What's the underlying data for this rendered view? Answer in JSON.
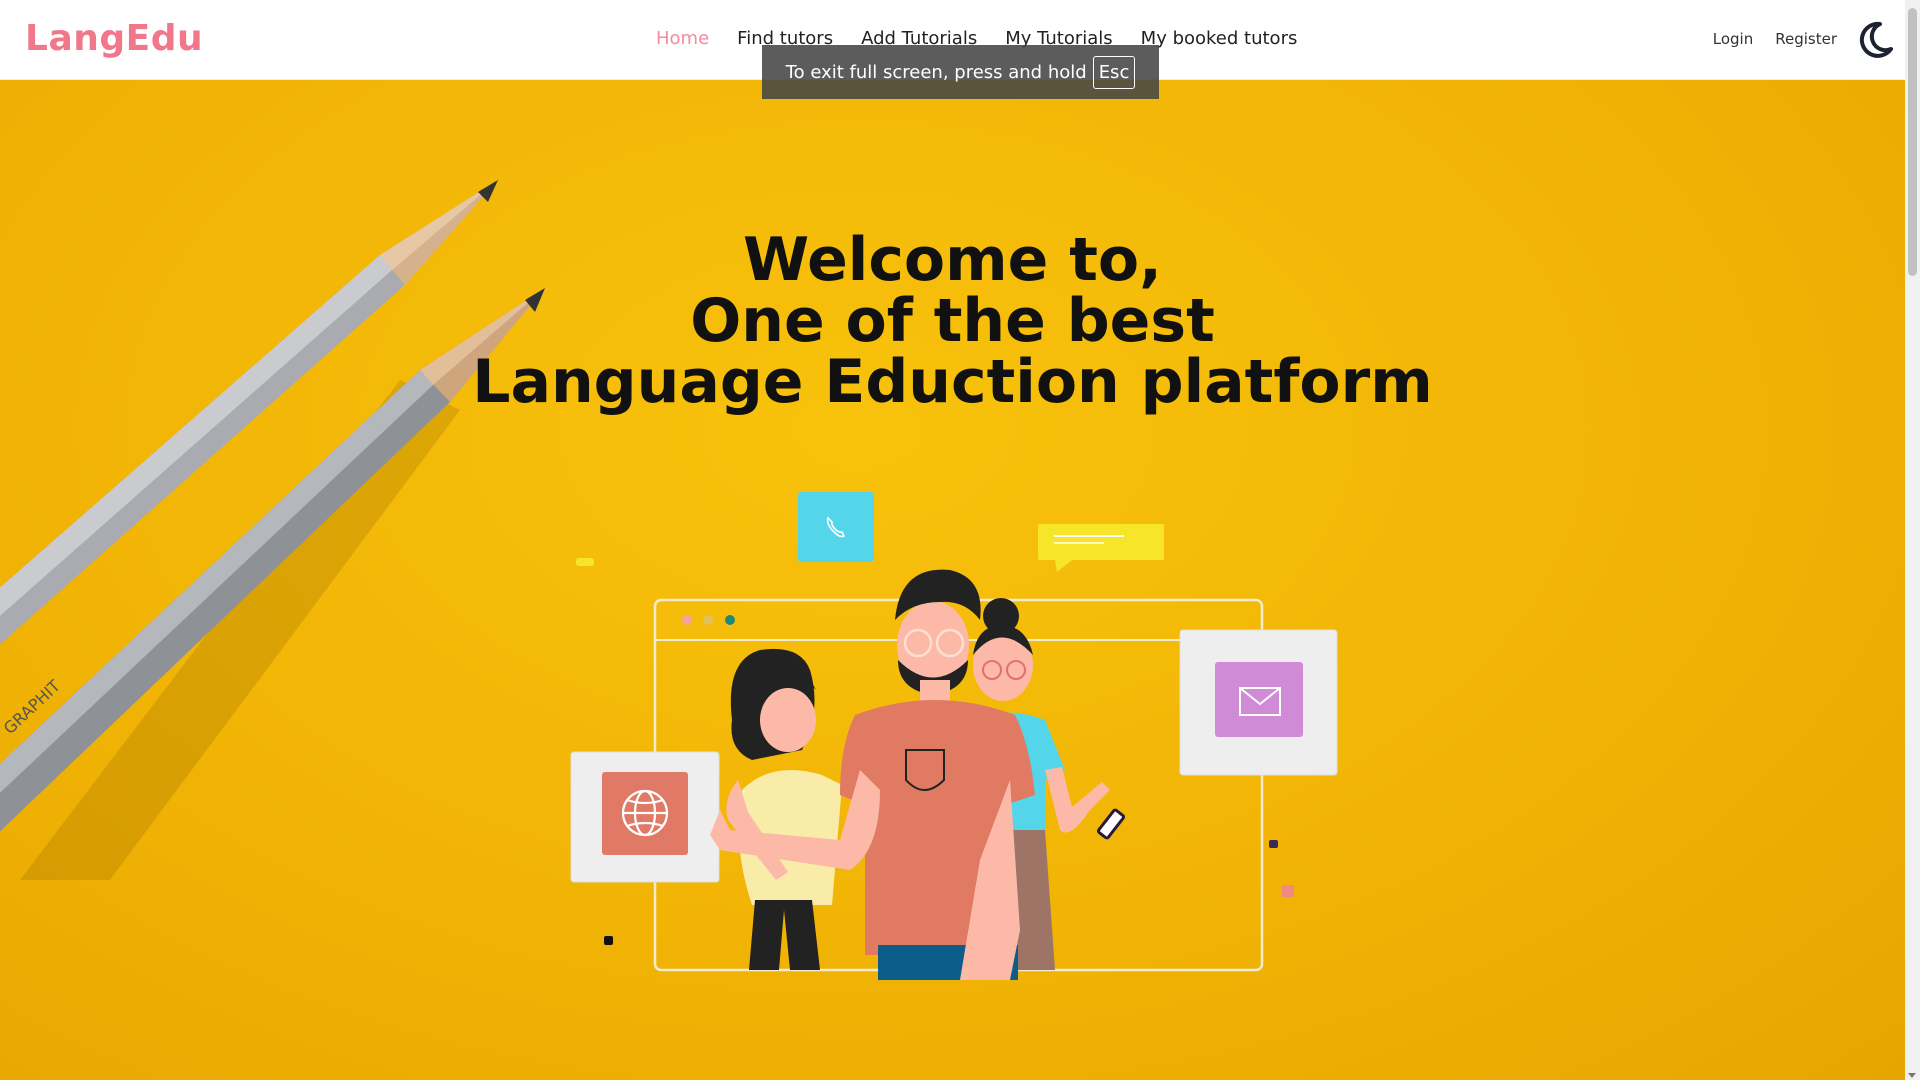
{
  "brand": "LangEdu",
  "nav": {
    "links": [
      "Home",
      "Find tutors",
      "Add Tutorials",
      "My Tutorials",
      "My booked tutors"
    ],
    "active_index": 0
  },
  "auth": {
    "login": "Login",
    "register": "Register"
  },
  "theme_toggle_icon": "moon-icon",
  "fullscreen_toast": {
    "text": "To exit full screen, press and hold",
    "key": "Esc"
  },
  "hero": {
    "lines": [
      "Welcome to,",
      "One of the best",
      "Language Eduction platform"
    ]
  },
  "colors": {
    "brand": "#f0788a",
    "active_link": "#f58aa0",
    "hero_bg": "#f1b405"
  }
}
